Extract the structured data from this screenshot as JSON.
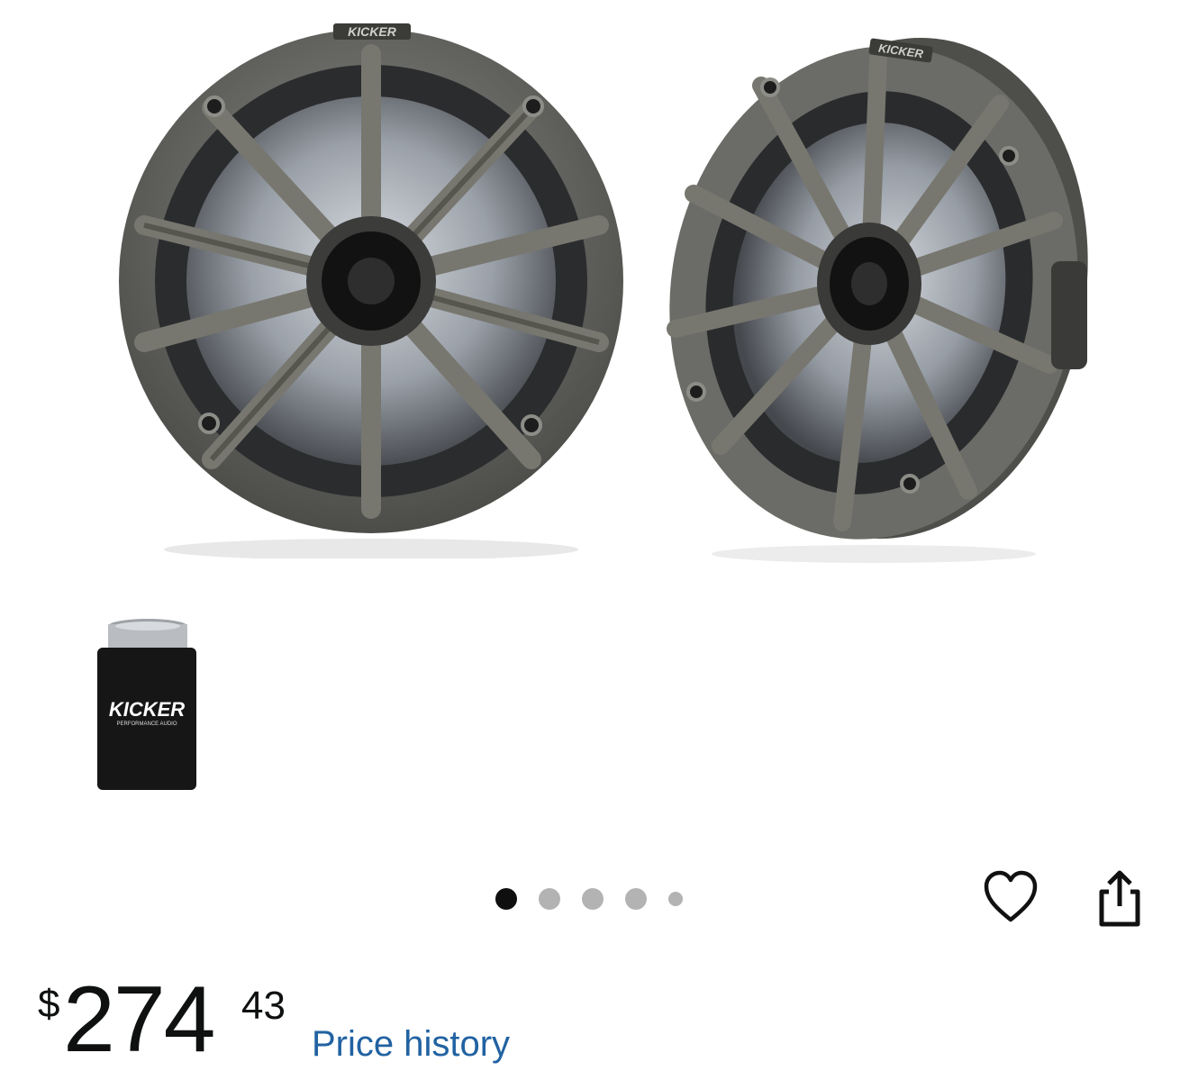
{
  "product": {
    "brand_label": "KICKER",
    "koozie_brand": "KICKER",
    "koozie_tagline": "PERFORMANCE AUDIO"
  },
  "gallery": {
    "total_images": 5,
    "active_index": 0
  },
  "actions": {
    "favorite_icon": "heart-outline-icon",
    "share_icon": "share-icon"
  },
  "price": {
    "currency_symbol": "$",
    "whole": "274",
    "fraction": "43",
    "history_link": "Price history"
  },
  "colors": {
    "link": "#2162a1",
    "price_text": "#0f1111",
    "dot_active": "#0f0f0f",
    "dot_inactive": "#b3b3b3",
    "speaker_grille": "#6c6c68"
  }
}
